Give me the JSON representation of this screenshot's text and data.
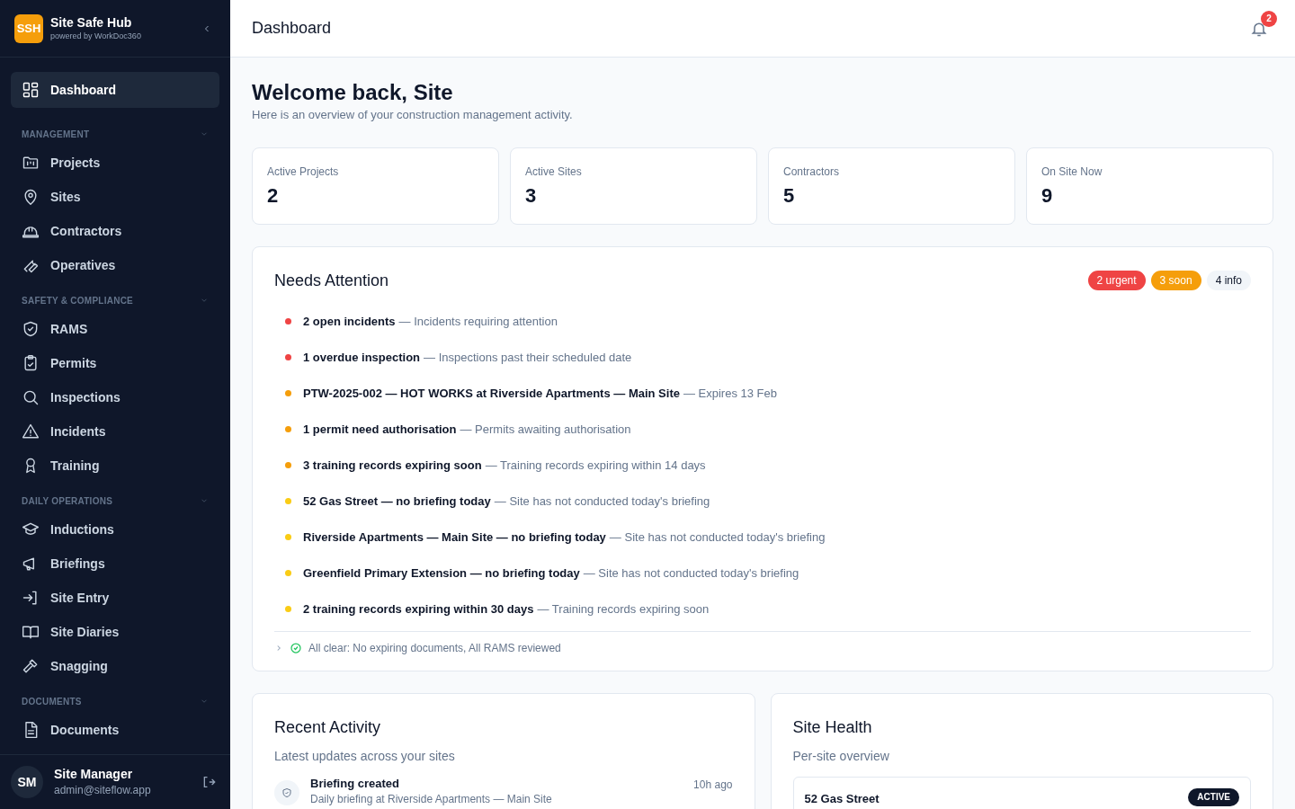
{
  "brand": {
    "logo": "SSH",
    "name": "Site Safe Hub",
    "tagline": "powered by WorkDoc360"
  },
  "nav": [
    {
      "items": [
        {
          "label": "Dashboard",
          "selected": true
        }
      ]
    },
    {
      "heading": "MANAGEMENT",
      "expanded": true,
      "items": [
        {
          "label": "Projects",
          "selected": false
        },
        {
          "label": "Sites",
          "selected": false
        },
        {
          "label": "Contractors",
          "selected": false
        },
        {
          "label": "Operatives",
          "selected": false
        }
      ]
    },
    {
      "heading": "SAFETY & COMPLIANCE",
      "expanded": true,
      "items": [
        {
          "label": "RAMS",
          "selected": false
        },
        {
          "label": "Permits",
          "selected": false
        },
        {
          "label": "Inspections",
          "selected": false
        },
        {
          "label": "Incidents",
          "selected": false
        },
        {
          "label": "Training",
          "selected": false
        }
      ]
    },
    {
      "heading": "DAILY OPERATIONS",
      "expanded": true,
      "items": [
        {
          "label": "Inductions",
          "selected": false
        },
        {
          "label": "Briefings",
          "selected": false
        },
        {
          "label": "Site Entry",
          "selected": false
        },
        {
          "label": "Site Diaries",
          "selected": false
        },
        {
          "label": "Snagging",
          "selected": false
        }
      ]
    },
    {
      "heading": "DOCUMENTS",
      "expanded": true,
      "items": [
        {
          "label": "Documents",
          "selected": false
        }
      ]
    }
  ],
  "user": {
    "initials": "SM",
    "name": "Site Manager",
    "email": "admin@siteflow.app"
  },
  "header": {
    "title": "Dashboard",
    "notifications": "2"
  },
  "welcome": {
    "title": "Welcome back, Site",
    "subtitle": "Here is an overview of your construction management activity."
  },
  "stats": [
    {
      "label": "Active Projects",
      "value": "2"
    },
    {
      "label": "Active Sites",
      "value": "3"
    },
    {
      "label": "Contractors",
      "value": "5"
    },
    {
      "label": "On Site Now",
      "value": "9"
    }
  ],
  "attention": {
    "title": "Needs Attention",
    "badges": [
      {
        "label": "2 urgent",
        "color": "#ef4444"
      },
      {
        "label": "3 soon",
        "color": "#f59e0b"
      },
      {
        "label": "4 info",
        "color": "#f1f5f9"
      }
    ],
    "items": [
      {
        "title": "2 open incidents",
        "detail": "— Incidents requiring attention",
        "color": "#ef4444"
      },
      {
        "title": "1 overdue inspection",
        "detail": "— Inspections past their scheduled date",
        "color": "#ef4444"
      },
      {
        "title": "PTW-2025-002 — HOT WORKS at Riverside Apartments — Main Site",
        "detail": "— Expires 13 Feb",
        "color": "#f59e0b"
      },
      {
        "title": "1 permit need authorisation",
        "detail": "— Permits awaiting authorisation",
        "color": "#f59e0b"
      },
      {
        "title": "3 training records expiring soon",
        "detail": "— Training records expiring within 14 days",
        "color": "#f59e0b"
      },
      {
        "title": "52 Gas Street — no briefing today",
        "detail": "— Site has not conducted today's briefing",
        "color": "#facc15"
      },
      {
        "title": "Riverside Apartments — Main Site — no briefing today",
        "detail": "— Site has not conducted today's briefing",
        "color": "#facc15"
      },
      {
        "title": "Greenfield Primary Extension — no briefing today",
        "detail": "— Site has not conducted today's briefing",
        "color": "#facc15"
      },
      {
        "title": "2 training records expiring within 30 days",
        "detail": "— Training records expiring soon",
        "color": "#facc15"
      }
    ],
    "all_clear": {
      "text": "All clear: No expiring documents, All RAMS reviewed",
      "expanded": false
    }
  },
  "activity": {
    "title": "Recent Activity",
    "subtitle": "Latest updates across your sites",
    "items": [
      {
        "title": "Briefing created",
        "detail": "Daily briefing at Riverside Apartments — Main Site",
        "time": "10h ago"
      }
    ]
  },
  "health": {
    "title": "Site Health",
    "subtitle": "Per-site overview",
    "sites": [
      {
        "name": "52 Gas Street",
        "status": "ACTIVE"
      }
    ]
  }
}
